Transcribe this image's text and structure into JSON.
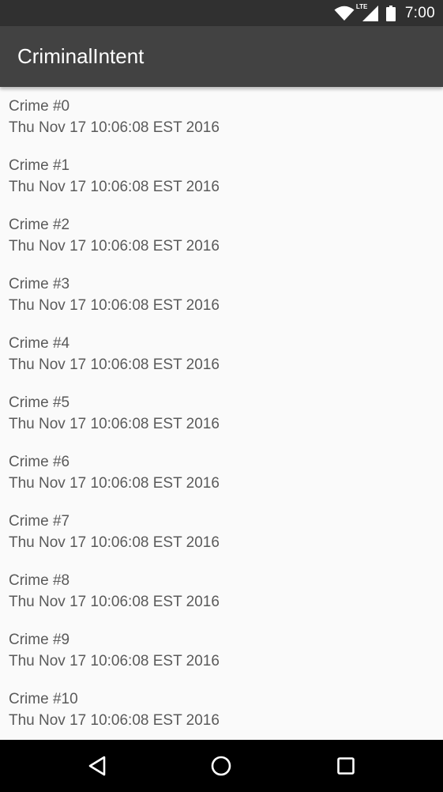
{
  "status_bar": {
    "time": "7:00",
    "icons": [
      "wifi-icon",
      "lte-signal-icon",
      "battery-icon"
    ],
    "lte_label": "LTE"
  },
  "app_bar": {
    "title": "CriminalIntent"
  },
  "crimes": [
    {
      "title": "Crime #0",
      "date": "Thu Nov 17 10:06:08 EST 2016"
    },
    {
      "title": "Crime #1",
      "date": "Thu Nov 17 10:06:08 EST 2016"
    },
    {
      "title": "Crime #2",
      "date": "Thu Nov 17 10:06:08 EST 2016"
    },
    {
      "title": "Crime #3",
      "date": "Thu Nov 17 10:06:08 EST 2016"
    },
    {
      "title": "Crime #4",
      "date": "Thu Nov 17 10:06:08 EST 2016"
    },
    {
      "title": "Crime #5",
      "date": "Thu Nov 17 10:06:08 EST 2016"
    },
    {
      "title": "Crime #6",
      "date": "Thu Nov 17 10:06:08 EST 2016"
    },
    {
      "title": "Crime #7",
      "date": "Thu Nov 17 10:06:08 EST 2016"
    },
    {
      "title": "Crime #8",
      "date": "Thu Nov 17 10:06:08 EST 2016"
    },
    {
      "title": "Crime #9",
      "date": "Thu Nov 17 10:06:08 EST 2016"
    },
    {
      "title": "Crime #10",
      "date": "Thu Nov 17 10:06:08 EST 2016"
    }
  ],
  "nav_bar": {
    "buttons": [
      "back-icon",
      "home-icon",
      "recents-icon"
    ]
  },
  "colors": {
    "status_bar": "#303030",
    "app_bar": "#424242",
    "background": "#fafafa",
    "text": "#5a5a5a",
    "nav_bar": "#000000"
  }
}
